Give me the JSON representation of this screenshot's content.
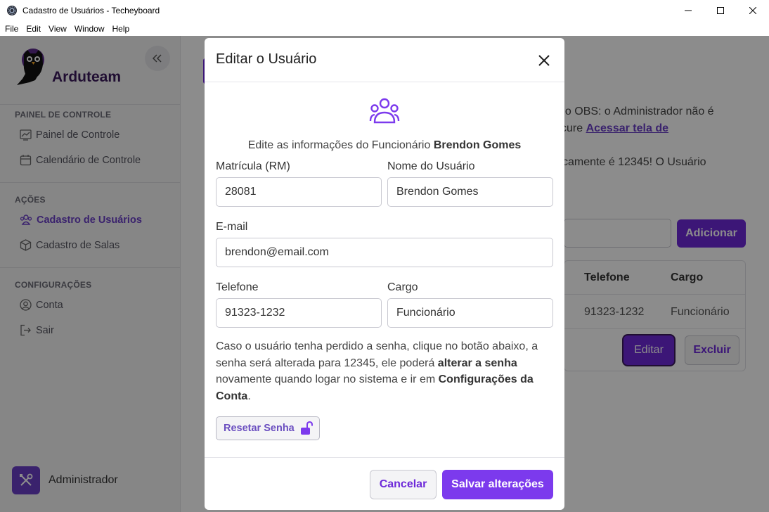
{
  "window": {
    "title": "Cadastro de Usuários - Techeyboard",
    "menu": [
      "File",
      "Edit",
      "View",
      "Window",
      "Help"
    ]
  },
  "sidebar": {
    "brand": "Arduteam",
    "sections": [
      {
        "title": "PAINEL DE CONTROLE",
        "items": [
          "Painel de Controle",
          "Calendário de Controle"
        ]
      },
      {
        "title": "AÇÕES",
        "items": [
          "Cadastro de Usuários",
          "Cadastro de Salas"
        ]
      },
      {
        "title": "CONFIGURAÇÕES",
        "items": [
          "Conta",
          "Sair"
        ]
      }
    ],
    "active_item": "Cadastro de Usuários",
    "user_name": "Administrador"
  },
  "background": {
    "text_line1": "no OBS: o Administrador não é",
    "text_line2_prefix": "cure ",
    "text_line2_link": "Acessar tela de",
    "text_line3": "camente é 12345! O Usuário",
    "add_button": "Adicionar",
    "table_headers": [
      "Telefone",
      "Cargo"
    ],
    "table_row": [
      "91323-1232",
      "Funcionário"
    ],
    "edit_button": "Editar",
    "delete_button": "Excluir"
  },
  "modal": {
    "title": "Editar o Usuário",
    "description_prefix": "Edite as informações do Funcionário ",
    "employee_name": "Brendon Gomes",
    "fields": {
      "rm_label": "Matrícula (RM)",
      "rm_value": "28081",
      "name_label": "Nome do Usuário",
      "name_value": "Brendon Gomes",
      "email_label": "E-mail",
      "email_value": "brendon@email.com",
      "phone_label": "Telefone",
      "phone_value": "91323-1232",
      "role_label": "Cargo",
      "role_value": "Funcionário"
    },
    "help": {
      "part1": "Caso o usuário tenha perdido a senha, clique no botão abaixo, a senha será alterada para 12345, ele poderá ",
      "bold1": "alterar a senha",
      "part2": " novamente quando logar no sistema e ir em ",
      "bold2": "Configurações da Conta",
      "part3": "."
    },
    "reset_button": "Resetar Senha",
    "cancel_button": "Cancelar",
    "save_button": "Salvar alterações"
  },
  "colors": {
    "accent": "#6d28d9",
    "accent_light": "#7c3aed",
    "brand_text": "#3b1a5c"
  }
}
